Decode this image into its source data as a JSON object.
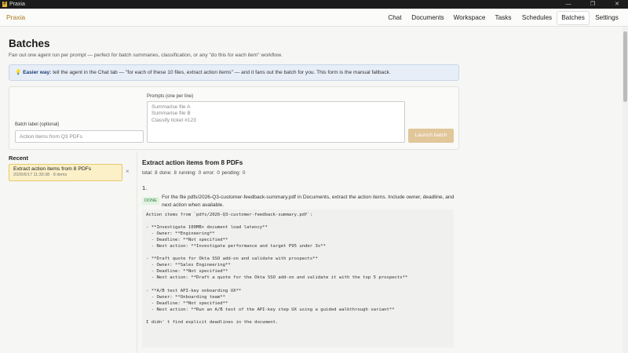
{
  "window": {
    "title": "Praxia",
    "icon_letter": "P",
    "controls": [
      "—",
      "❐",
      "✕"
    ]
  },
  "nav": {
    "brand": "Praxia",
    "tabs": [
      {
        "label": "Chat"
      },
      {
        "label": "Documents"
      },
      {
        "label": "Workspace"
      },
      {
        "label": "Tasks"
      },
      {
        "label": "Schedules"
      },
      {
        "label": "Batches",
        "active": true
      },
      {
        "label": "Settings"
      }
    ]
  },
  "page": {
    "title": "Batches",
    "subtitle": "Fan out one agent run per prompt — perfect for batch summaries, classification, or any \"do this for each item\" workflow."
  },
  "tip": {
    "icon": "lightbulb-icon",
    "bold": "Easier way:",
    "text": "tell the agent in the Chat tab — \"for each of these 10 files, extract action items\" — and it fans out the batch for you. This form is the manual fallback."
  },
  "form": {
    "batch_label_label": "Batch label (optional)",
    "batch_label_placeholder": "Action items from Q3 PDFs",
    "prompts_label": "Prompts (one per line)",
    "prompts_placeholder_lines": [
      "Summarise file A",
      "Summarise file B",
      "Classify ticket #123"
    ],
    "launch_label": "Launch batch"
  },
  "recent": {
    "title": "Recent",
    "items": [
      {
        "title": "Extract action items from 8 PDFs",
        "meta": "2026/6/17 11:39:38 · 8 items",
        "close": "×"
      }
    ]
  },
  "detail": {
    "title": "Extract action items from 8 PDFs",
    "stats": "total: 8  done: 8  running: 0  error: 0  pending: 0",
    "items": [
      {
        "number": "1.",
        "status": "DONE",
        "prompt": "For the file pdfs/2026-Q3-customer-feedback-summary.pdf in Documents, extract the action items. Include owner, deadline, and next action when available.",
        "output_lines": [
          "Action items from `pdfs/2026-Q3-customer-feedback-summary.pdf`:",
          "",
          "- **Investigate 100MB+ document load latency**",
          "  - Owner: **Engineering**",
          "  - Deadline: **Not specified**",
          "  - Next action: **Investigate performance and target P95 under 3s**",
          "",
          "- **Draft quote for Okta SSO add-on and validate with prospects**",
          "  - Owner: **Sales Engineering**",
          "  - Deadline: **Not specified**",
          "  - Next action: **Draft a quote for the Okta SSO add-on and validate it with the top 5 prospects**",
          "",
          "- **A/B test API-key onboarding UX**",
          "  - Owner: **Onboarding team**",
          "  - Deadline: **Not specified**",
          "  - Next action: **Run an A/B test of the API-key step UX using a guided walkthrough variant**",
          "",
          "I didn' t find explicit deadlines in the document."
        ]
      }
    ]
  }
}
